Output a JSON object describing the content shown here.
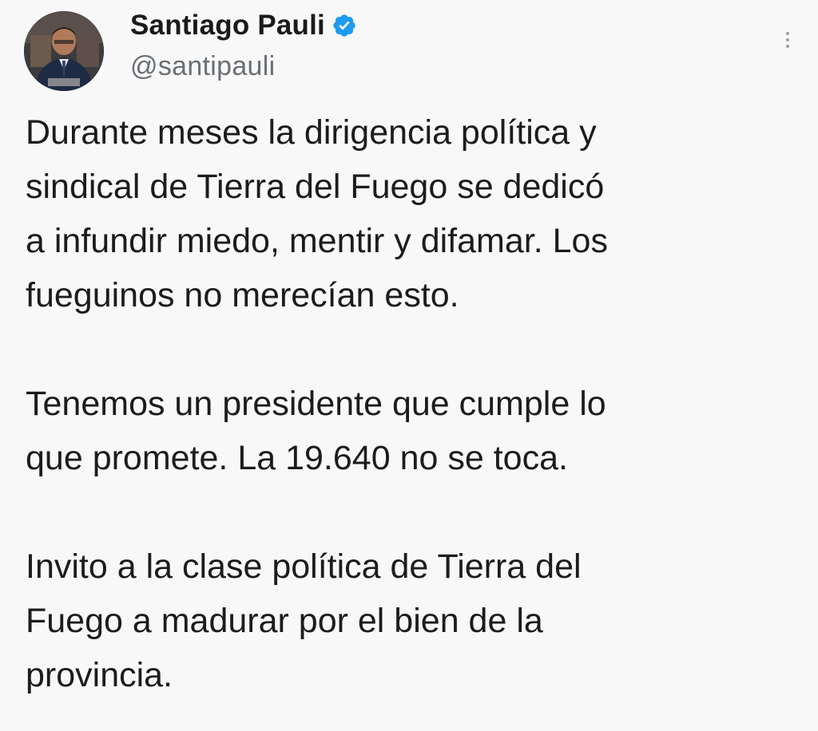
{
  "author": {
    "display_name": "Santiago Pauli",
    "handle": "@santipauli",
    "verified": true,
    "verified_color": "#1d9bf0"
  },
  "icons": {
    "verified": "verified-badge-icon",
    "more": "more-options-icon"
  },
  "tweet": {
    "paragraphs": [
      "Durante meses la dirigencia política y\nsindical de Tierra del Fuego se dedicó\na infundir miedo, mentir y difamar. Los\nfueguinos no merecían esto.",
      "Tenemos un presidente que cumple lo\nque promete. La 19.640 no se toca.",
      "Invito a la clase política de Tierra del\nFuego a madurar por el bien de la\nprovincia."
    ]
  }
}
